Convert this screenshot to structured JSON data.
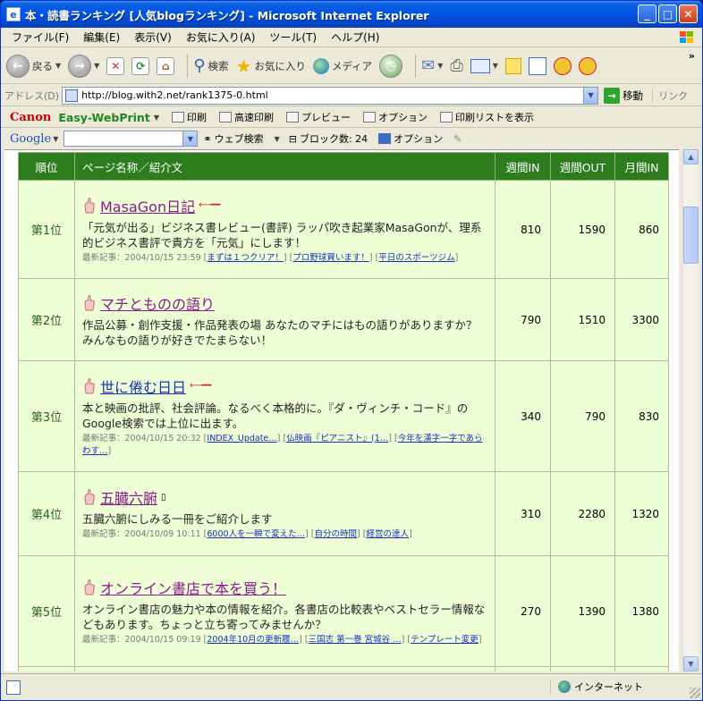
{
  "window": {
    "title": "本・読書ランキング [人気blogランキング] - Microsoft Internet Explorer",
    "min": "_",
    "max": "□",
    "close": "✕"
  },
  "menu": [
    "ファイル(F)",
    "編集(E)",
    "表示(V)",
    "お気に入り(A)",
    "ツール(T)",
    "ヘルプ(H)"
  ],
  "toolbar": {
    "back": "戻る",
    "search": "検索",
    "favorites": "お気に入り",
    "media": "メディア"
  },
  "address": {
    "label": "アドレス(D)",
    "url": "http://blog.with2.net/rank1375-0.html",
    "go": "移動",
    "links": "リンク"
  },
  "canon": {
    "logo": "Canon",
    "product": "Easy-WebPrint",
    "print": "印刷",
    "fast_print": "高速印刷",
    "preview": "プレビュー",
    "options": "オプション",
    "print_list": "印刷リストを表示"
  },
  "google": {
    "logo": "Google",
    "web_search": "ウェブ検索",
    "blocked": "ブロック数: 24",
    "options": "オプション"
  },
  "table": {
    "headers": {
      "rank": "順位",
      "page": "ページ名称／紹介文",
      "week_in": "週間IN",
      "week_out": "週間OUT",
      "month_in": "月間IN"
    },
    "rows": [
      {
        "rank": "第1位",
        "title": "MasaGon日記",
        "blurb": "「元気が出る」ビジネス書レビュー(書評) ラッパ吹き起業家MasaGonが、理系的ビジネス書評で貴方を「元気」にします！",
        "recent_label": "最新記事：2004/10/15 23:59",
        "links": [
          "まずは１つクリア！",
          "プロ野球買います！",
          "平日のスポーツジム"
        ],
        "week_in": "810",
        "week_out": "1590",
        "month_in": "860"
      },
      {
        "rank": "第2位",
        "title": "マチとものの語り",
        "blurb": "作品公募・創作支援・作品発表の場 あなたのマチにはもの語りがありますか？みんなもの語りが好きでたまらない！",
        "week_in": "790",
        "week_out": "1510",
        "month_in": "3300"
      },
      {
        "rank": "第3位",
        "title": "世に倦む日日",
        "blurb": "本と映画の批評、社会評論。なるべく本格的に。『ダ・ヴィンチ・コード』のGoogle検索では上位に出ます。",
        "recent_label": "最新記事：2004/10/15 20:32",
        "links": [
          "INDEX_Update…",
          "仏映画『ピアニスト』(1…",
          "今年を漢字一字であらわす…"
        ],
        "week_in": "340",
        "week_out": "790",
        "month_in": "830"
      },
      {
        "rank": "第4位",
        "title": "五臓六腑",
        "blurb": "五臓六腑にしみる一冊をご紹介します",
        "recent_label": "最新記事：2004/10/09 10:11",
        "links": [
          "6000人を一瞬で変えた…",
          "自分の時間",
          "経営の達人"
        ],
        "week_in": "310",
        "week_out": "2280",
        "month_in": "1320"
      },
      {
        "rank": "第5位",
        "title": "オンライン書店で本を買う！",
        "blurb": "オンライン書店の魅力や本の情報を紹介。各書店の比較表やベストセラー情報などもあります。ちょっと立ち寄ってみませんか？",
        "recent_label": "最新記事：2004/10/15 09:19",
        "links": [
          "2004年10月の更新履…",
          "三国志 第一巻 宮城谷 …",
          "テンプレート変更"
        ],
        "week_in": "270",
        "week_out": "1390",
        "month_in": "1380"
      }
    ]
  },
  "status": {
    "zone": "インターネット"
  }
}
